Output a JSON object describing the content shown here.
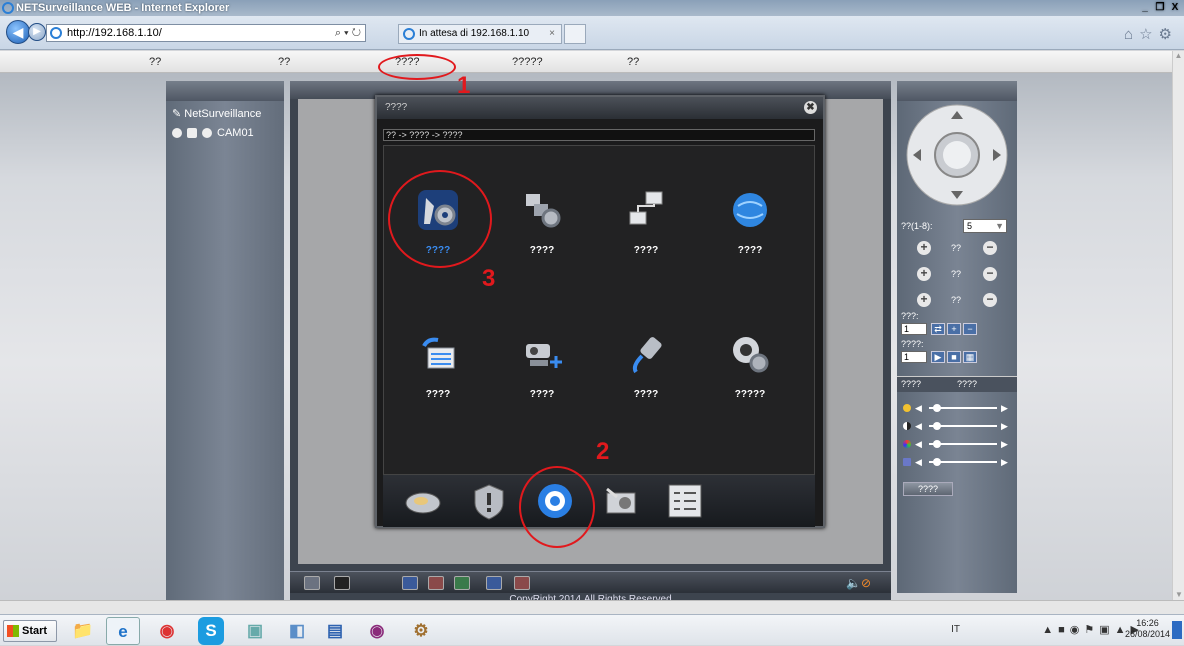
{
  "window": {
    "title": "NETSurveillance WEB - Internet Explorer",
    "controls": [
      "_",
      "❒",
      "X"
    ]
  },
  "browser": {
    "address": "http://192.168.1.10/",
    "tab_label": "In attesa di 192.168.1.10",
    "tab_close": "×",
    "address_tools": "⌕ ▾  ↻"
  },
  "menu": {
    "items": [
      "??",
      "??",
      "????",
      "?????",
      "??"
    ]
  },
  "annotations": [
    "1",
    "2",
    "3"
  ],
  "left_panel": {
    "title": "NetSurveillance",
    "camera": "CAM01"
  },
  "dialog": {
    "title": "????",
    "close": "✖",
    "breadcrumb": "?? -> ???? -> ????",
    "icons": [
      {
        "label": "????",
        "icon": "general-settings-icon",
        "selected": true
      },
      {
        "label": "????",
        "icon": "encode-settings-icon",
        "selected": false
      },
      {
        "label": "????",
        "icon": "network-settings-icon",
        "selected": false
      },
      {
        "label": "????",
        "icon": "network-services-icon",
        "selected": false
      },
      {
        "label": "????",
        "icon": "gui-display-icon",
        "selected": false
      },
      {
        "label": "????",
        "icon": "ptz-config-icon",
        "selected": false
      },
      {
        "label": "????",
        "icon": "rs232-icon",
        "selected": false
      },
      {
        "label": "?????",
        "icon": "camera-param-icon",
        "selected": false
      }
    ],
    "bottom_tabs": [
      "record-tab",
      "alarm-tab",
      "system-tab",
      "advanced-tab",
      "info-tab"
    ]
  },
  "right_panel": {
    "speed_label": "??(1-8):",
    "speed_value": "5",
    "zoom_label": "??",
    "focus_label": "??",
    "iris_label": "??",
    "preset_label": "???:",
    "preset_value": "1",
    "cruise_label": "????:",
    "cruise_value": "1",
    "tab1": "????",
    "tab2": "????",
    "default_button": "????"
  },
  "footer": {
    "copyright": "CopyRight 2014,All Rights Reserved"
  },
  "taskbar": {
    "start": "Start",
    "lang": "IT",
    "time": "16:26",
    "date": "26/08/2014"
  },
  "colors": {
    "annotation_red": "#e1191d",
    "selected_label": "#3a8cf0",
    "dialog_bg": "#1b1b1c"
  }
}
